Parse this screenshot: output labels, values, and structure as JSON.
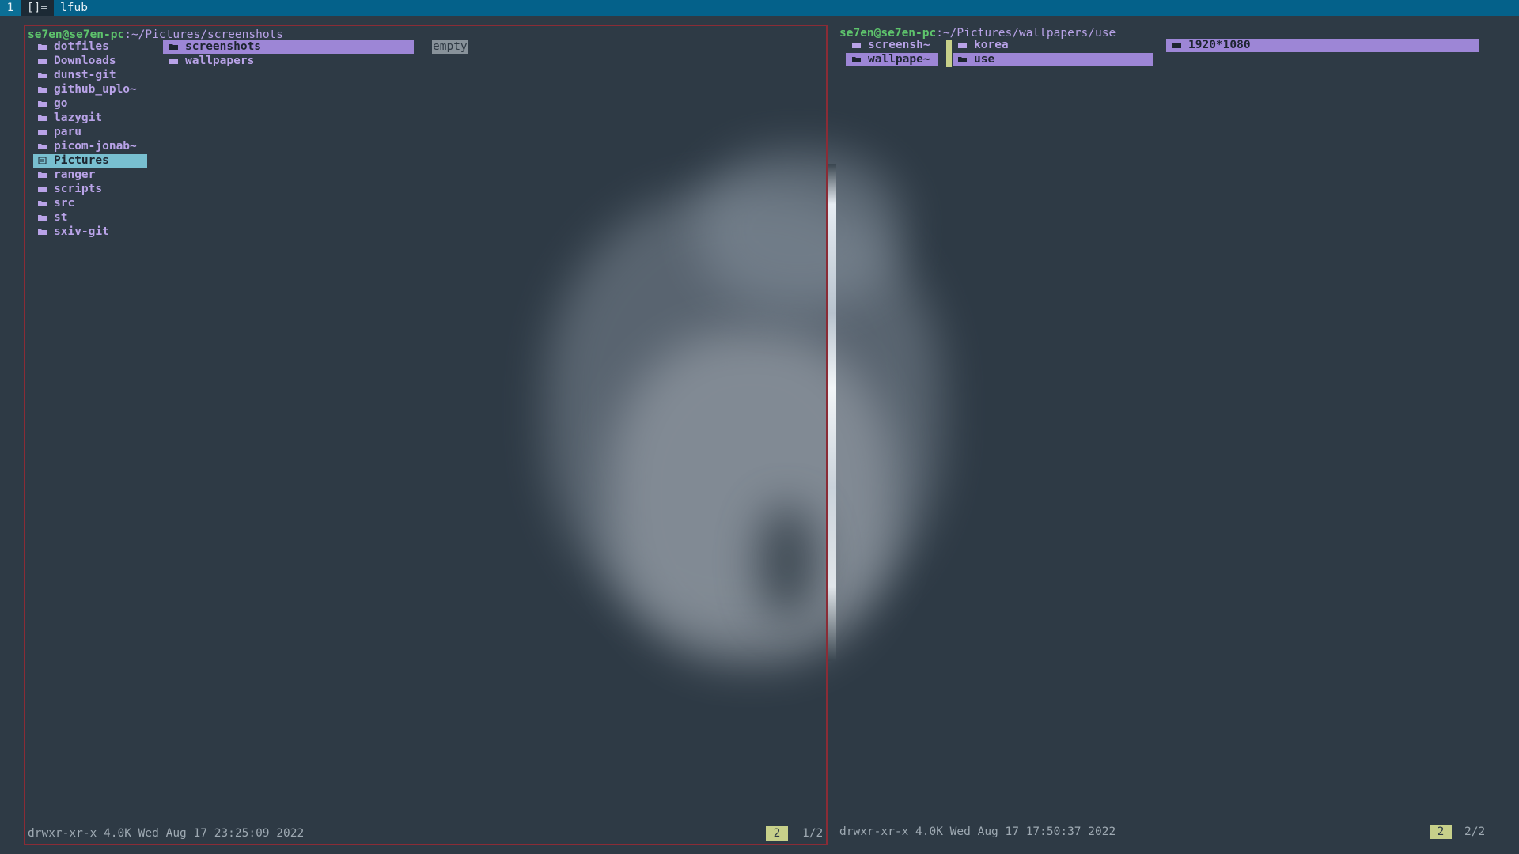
{
  "bar": {
    "tag": "1",
    "layout": "[]=",
    "title": "lfub"
  },
  "left": {
    "host": "se7en@se7en-pc",
    "path": ":~/Pictures/screenshots",
    "parent_items": [
      "dotfiles",
      "Downloads",
      "dunst-git",
      "github_uplo~",
      "go",
      "lazygit",
      "paru",
      "picom-jonab~",
      "Pictures",
      "ranger",
      "scripts",
      "src",
      "st",
      "sxiv-git"
    ],
    "parent_selected": "Pictures",
    "current_items": [
      "screenshots",
      "wallpapers"
    ],
    "current_selected": "screenshots",
    "preview": "empty",
    "status": "drwxr-xr-x 4.0K Wed Aug 17 23:25:09 2022",
    "badge": "2",
    "position": "1/2"
  },
  "right": {
    "host": "se7en@se7en-pc",
    "path": ":~/Pictures/wallpapers/use",
    "parent_items": [
      "screensh~",
      "wallpape~"
    ],
    "current_items": [
      "korea",
      "use"
    ],
    "preview_items": [
      "1920*1080"
    ],
    "status": "drwxr-xr-x 4.0K Wed Aug 17 17:50:37 2022",
    "badge": "2",
    "position": "2/2"
  },
  "colors": {
    "accent_purple": "#9d86d6",
    "cursor_cyan": "#78bfd0",
    "host_green": "#5ec46c",
    "border_red": "#8a2c36",
    "bar_blue": "#04618a"
  },
  "icons": {
    "folder": "folder-icon",
    "folder_open": "folder-open-icon"
  }
}
